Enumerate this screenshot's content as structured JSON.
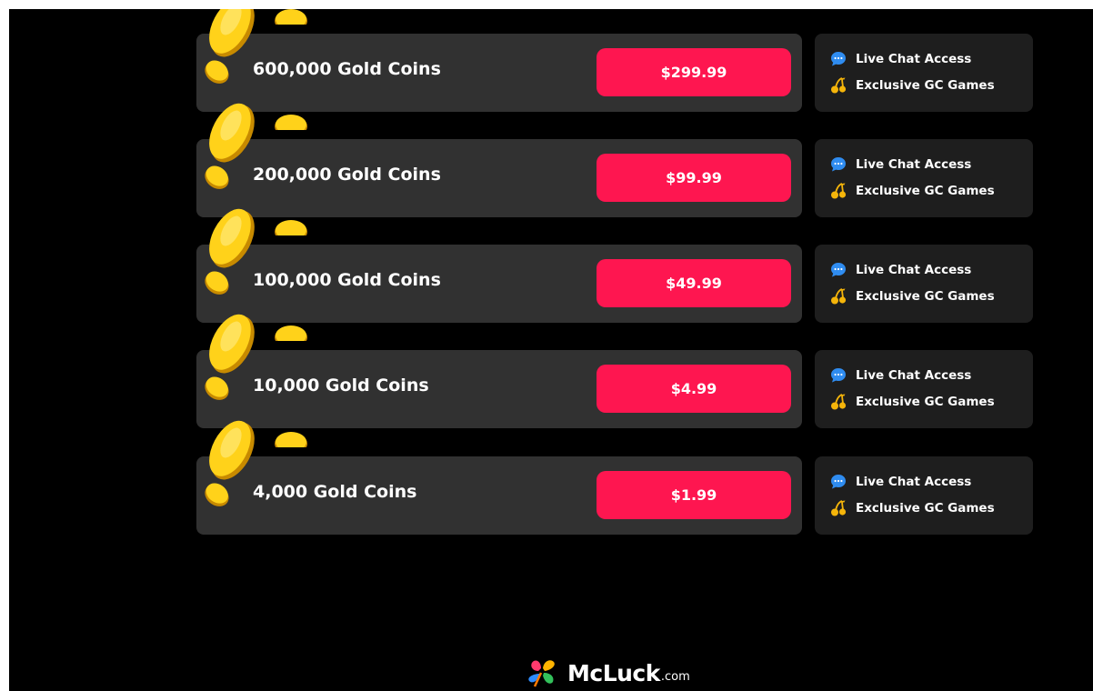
{
  "packages": [
    {
      "amount": "600,000 Gold Coins",
      "price": "$299.99"
    },
    {
      "amount": "200,000 Gold Coins",
      "price": "$99.99"
    },
    {
      "amount": "100,000 Gold Coins",
      "price": "$49.99"
    },
    {
      "amount": "10,000 Gold Coins",
      "price": "$4.99"
    },
    {
      "amount": "4,000 Gold Coins",
      "price": "$1.99"
    }
  ],
  "perks": {
    "live_chat": "Live Chat Access",
    "exclusive_games": "Exclusive GC Games",
    "live_chat_icon": "chat-bubble-icon",
    "exclusive_games_icon": "cherries-icon"
  },
  "footer": {
    "brand": "McLuck",
    "tld": ".com",
    "logo_icon": "clover-logo-icon"
  },
  "colors": {
    "background": "#000000",
    "package_bg": "#313131",
    "perks_bg": "#1e1e1e",
    "buy_button": "#fe1650",
    "coin_gold": "#f7c815",
    "chat_icon": "#2f8cf0",
    "cherries_icon": "#f5b50a"
  }
}
